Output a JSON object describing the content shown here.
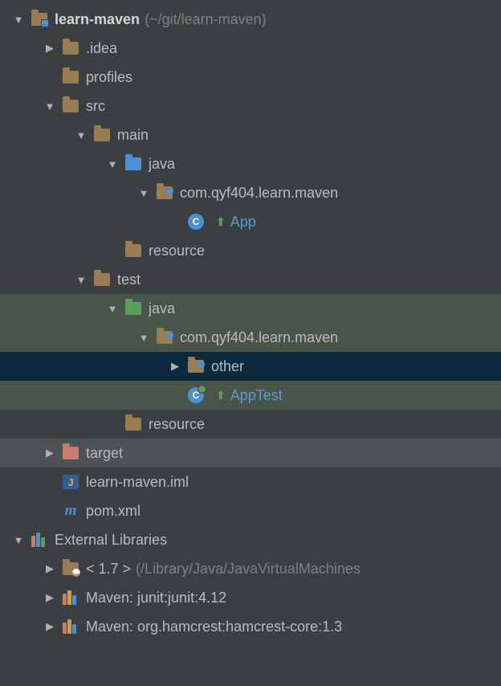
{
  "root": {
    "name": "learn-maven",
    "path": "(~/git/learn-maven)"
  },
  "idea": ".idea",
  "profiles": "profiles",
  "src": "src",
  "main": "main",
  "main_java": "java",
  "main_pkg": "com.qyf404.learn.maven",
  "main_class": "App",
  "main_resource": "resource",
  "test": "test",
  "test_java": "java",
  "test_pkg": "com.qyf404.learn.maven",
  "test_other": "other",
  "test_class": "AppTest",
  "test_resource": "resource",
  "target": "target",
  "iml": "learn-maven.iml",
  "pom": "pom.xml",
  "ext_libs": "External Libraries",
  "jdk": {
    "name": "< 1.7 >",
    "path": "(/Library/Java/JavaVirtualMachines"
  },
  "lib1": "Maven: junit:junit:4.12",
  "lib2": "Maven: org.hamcrest:hamcrest-core:1.3"
}
